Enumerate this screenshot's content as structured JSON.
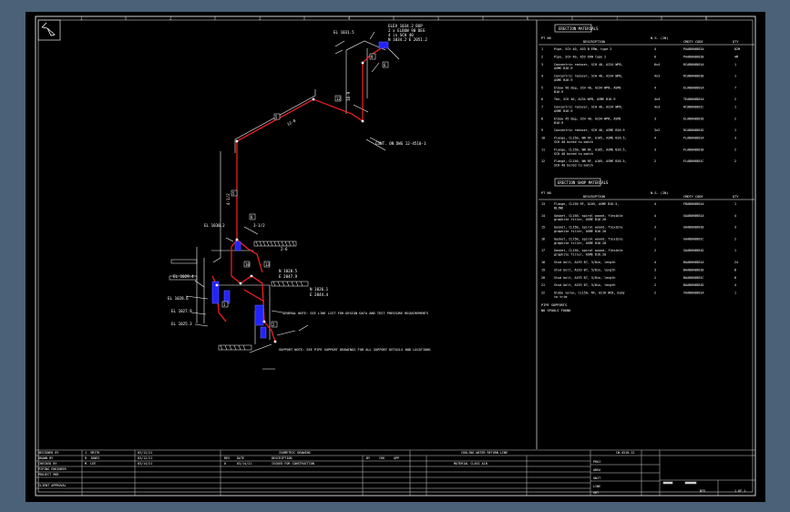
{
  "window": {
    "background": "#4a6177",
    "canvas": "#000000"
  },
  "colors": {
    "line": "#ffffff",
    "pipe": "#ff2020",
    "fitting": "#2323ff",
    "border": "#cfcfcf"
  },
  "border_marks": {
    "top": [
      "1",
      "2",
      "3",
      "4",
      "5",
      "6",
      "7",
      "8"
    ]
  },
  "erection_table": {
    "title": "ERECTION MATERIALS",
    "headers": [
      "PT NO",
      "DESCRIPTION",
      "N.S. (IN)",
      "CMDTY CODE",
      "QTY"
    ],
    "rows": [
      {
        "pt": "1",
        "desc": "Pipe, SCH 40, A53 B ERW, type 2",
        "ns": "4",
        "code": "PAAB0H0B81A",
        "qty": "82M"
      },
      {
        "pt": "2",
        "desc": "Pipe, SCH 40, A53 ERW type 2",
        "ns": "6",
        "code": "PAAB0H0B81B",
        "qty": "4M"
      },
      {
        "pt": "3",
        "desc": "Concentric reducer, SCH 40, A234 WPB, ASME B16.9",
        "ns": "6x4",
        "code": "RCAB0H0B81A",
        "qty": "1"
      },
      {
        "pt": "4",
        "desc": "Concentric reducer, SCH 40, A234 WPB, ASME B16.9",
        "ns": "4x3",
        "code": "RCAB0H0B81B",
        "qty": "1"
      },
      {
        "pt": "5",
        "desc": "Elbow 90 deg, SCH 40, A234 WPB, ASME B16.9",
        "ns": "4",
        "code": "ELAB0H0B81A",
        "qty": "7"
      },
      {
        "pt": "6",
        "desc": "Tee, SCH 40, A234 WPB, ASME B16.9",
        "ns": "4x4",
        "code": "TEAB0H0B81A",
        "qty": "2"
      },
      {
        "pt": "7",
        "desc": "Concentric reducer, SCH 40, A234 WPB, ASME B16.9",
        "ns": "4x3",
        "code": "RCAB0H0B81C",
        "qty": "1"
      },
      {
        "pt": "8",
        "desc": "Elbow 45 deg, SCH 40, A234 WPB, ASME B16.9",
        "ns": "3",
        "code": "ELAB0H0B81B",
        "qty": "2"
      },
      {
        "pt": "9",
        "desc": "Concentric reducer, SCH 40, ASME B16.9",
        "ns": "3x2",
        "code": "RCAB0H0B81D",
        "qty": "1"
      },
      {
        "pt": "10",
        "desc": "Flange, CL150, WN RF, A105, ASME B16.5, SCH 40 bored to match",
        "ns": "4",
        "code": "FLAB0H0B81A",
        "qty": "3"
      },
      {
        "pt": "11",
        "desc": "Flange, CL150, WN RF, A105, ASME B16.5, SCH 40 bored to match",
        "ns": "3",
        "code": "FLAB0H0B81B",
        "qty": "2"
      },
      {
        "pt": "12",
        "desc": "Flange, CL150, WN RF, A105, ASME B16.5, SCH 40 bored to match",
        "ns": "2",
        "code": "FLAB0H0B81C",
        "qty": "2"
      }
    ]
  },
  "fabrication_table": {
    "title": "ERECTION SHOP MATERIALS",
    "headers": [
      "PT NO",
      "DESCRIPTION",
      "N.S. (IN)",
      "CMDTY CODE",
      "QTY"
    ],
    "rows": [
      {
        "pt": "13",
        "desc": "Flange, CL150 RF, A105, ASME B16.5, BLIND",
        "ns": "4",
        "code": "FBAB0H0B81A",
        "qty": "1"
      },
      {
        "pt": "14",
        "desc": "Gasket, CL150, spiral wound, flexible graphite filler, ASME B16.20",
        "ns": "4",
        "code": "GAAB0H0B81A",
        "qty": "4"
      },
      {
        "pt": "15",
        "desc": "Gasket, CL150, spiral wound, flexible graphite filler, ASME B16.20",
        "ns": "3",
        "code": "GAAB0H0B81B",
        "qty": "3"
      },
      {
        "pt": "16",
        "desc": "Gasket, CL150, spiral wound, flexible graphite filler, ASME B16.20",
        "ns": "2",
        "code": "GAAB0H0B81C",
        "qty": "2"
      },
      {
        "pt": "17",
        "desc": "Gasket, CL150, spiral wound, flexible graphite filler, ASME B16.20",
        "ns": "2",
        "code": "GAAB0H0B81D",
        "qty": "1"
      },
      {
        "pt": "18",
        "desc": "Stud bolt, A193 B7, 5/8in, length",
        "ns": "4",
        "code": "BAAB0H0B81A",
        "qty": "24"
      },
      {
        "pt": "19",
        "desc": "Stud bolt, A193 B7, 5/8in, length",
        "ns": "3",
        "code": "BAAB0H0B81B",
        "qty": "8"
      },
      {
        "pt": "20",
        "desc": "Stud bolt, A193 B7, 5/8in, length",
        "ns": "2",
        "code": "BAAB0H0B81C",
        "qty": "8"
      },
      {
        "pt": "21",
        "desc": "Stud bolt, A193 B7, 5/8in, length",
        "ns": "2",
        "code": "BAAB0H0B81D",
        "qty": "4"
      },
      {
        "pt": "22",
        "desc": "Globe valve, CL150, RF, A216 WCB, body to trim",
        "ns": "2",
        "code": "VGAB0H0B81A",
        "qty": "1"
      }
    ],
    "notes": [
      "PIPE SUPPORTS",
      "NO SPOOLS FOUND"
    ]
  },
  "drawing_labels": {
    "note_top": [
      "ELEV 1034.2 BOP",
      "2 x ELBOW 90 DEG",
      "4 in SCH 40",
      "N 1034.2 E 2051.2"
    ],
    "note_mid": [
      "CONT. ON DWG 12-4510-1"
    ],
    "note_low1": "GENERAL NOTE: SEE LINE LIST FOR DESIGN DATA AND TEST PRESSURE REQUIREMENTS",
    "note_low2": "SUPPORT NOTE: SEE PIPE SUPPORT DRAWINGS FOR ALL SUPPORT DETAILS AND LOCATIONS",
    "elev_labels": [
      "EL 1031.5",
      "EL 1030.2",
      "EL 1029.4",
      "EL 1028.6",
      "EL 1027.9",
      "EL 1025.3"
    ],
    "small_tags": [
      "6",
      "9",
      "12",
      "5",
      "5",
      "8",
      "10",
      "13",
      "1",
      "2"
    ],
    "run_dims": [
      "3-1/2",
      "12-0",
      "4-1/2",
      "18-9",
      "2-6"
    ],
    "coord_tags": [
      "N 1028.5",
      "E 2047.9",
      "N 1026.1",
      "E 2044.4"
    ]
  },
  "title_block": {
    "left_rows": [
      "DESIGNED BY",
      "DRAWN BY",
      "CHECKED BY",
      "PIPING ENGINEER",
      "PROJECT MGR",
      "CLIENT APPROVAL"
    ],
    "left_values": [
      "J. SMITH",
      "R. JONES",
      "M. LEE",
      "",
      "",
      ""
    ],
    "dates": [
      "03/12/21",
      "03/12/21",
      "03/14/21",
      "",
      "",
      ""
    ],
    "rev_header": [
      "REV",
      "DATE",
      "DESCRIPTION",
      "BY",
      "CHK",
      "APP"
    ],
    "rev_row": [
      "0",
      "03/14/21",
      "ISSUED FOR CONSTRUCTION"
    ],
    "center_title": "ISOMETRIC DRAWING",
    "project_title": "COOLING WATER RETURN LINE",
    "material_class": "MATERIAL CLASS A1B",
    "drawing_no": "CW-4510-12",
    "sheet": "1 OF 1",
    "scale": "NTS",
    "small_cols": [
      "PROJ",
      "AREA",
      "UNIT",
      "LINE",
      "SHT"
    ]
  }
}
